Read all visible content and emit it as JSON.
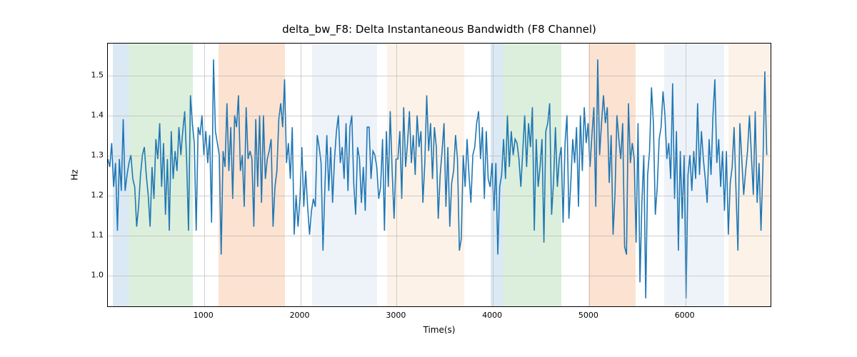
{
  "chart_data": {
    "type": "line",
    "title": "delta_bw_F8: Delta Instantaneous Bandwidth (F8 Channel)",
    "xlabel": "Time(s)",
    "ylabel": "Hz",
    "xlim": [
      0,
      6900
    ],
    "ylim": [
      0.92,
      1.58
    ],
    "xticks": [
      1000,
      2000,
      3000,
      4000,
      5000,
      6000
    ],
    "yticks": [
      1.0,
      1.1,
      1.2,
      1.3,
      1.4,
      1.5
    ],
    "bands": [
      {
        "x0": 50,
        "x1": 220,
        "color": "#a6c8e4"
      },
      {
        "x0": 220,
        "x1": 880,
        "color": "#a8d8a8"
      },
      {
        "x0": 1150,
        "x1": 1840,
        "color": "#f5b78b"
      },
      {
        "x0": 2120,
        "x1": 2800,
        "color": "#d4e2ef"
      },
      {
        "x0": 2900,
        "x1": 3700,
        "color": "#f8dec2"
      },
      {
        "x0": 3980,
        "x1": 4110,
        "color": "#a6c8e4"
      },
      {
        "x0": 4110,
        "x1": 4710,
        "color": "#a8d8a8"
      },
      {
        "x0": 4990,
        "x1": 5480,
        "color": "#f5b78b"
      },
      {
        "x0": 5780,
        "x1": 6400,
        "color": "#d4e2ef"
      },
      {
        "x0": 6450,
        "x1": 6900,
        "color": "#f8dec2"
      }
    ],
    "series": [
      {
        "name": "delta_bw_F8",
        "color": "#1f77b4",
        "x_step": 20,
        "x_start": 0,
        "values": [
          1.29,
          1.27,
          1.33,
          1.22,
          1.28,
          1.11,
          1.29,
          1.21,
          1.39,
          1.21,
          1.25,
          1.28,
          1.3,
          1.24,
          1.22,
          1.12,
          1.17,
          1.25,
          1.3,
          1.32,
          1.25,
          1.2,
          1.12,
          1.27,
          1.19,
          1.34,
          1.29,
          1.38,
          1.22,
          1.33,
          1.15,
          1.29,
          1.11,
          1.36,
          1.24,
          1.31,
          1.26,
          1.37,
          1.3,
          1.36,
          1.41,
          1.29,
          1.11,
          1.45,
          1.38,
          1.33,
          1.11,
          1.37,
          1.35,
          1.4,
          1.3,
          1.36,
          1.28,
          1.35,
          1.13,
          1.54,
          1.36,
          1.33,
          1.3,
          1.05,
          1.31,
          1.27,
          1.43,
          1.26,
          1.37,
          1.19,
          1.4,
          1.37,
          1.45,
          1.26,
          1.3,
          1.17,
          1.42,
          1.29,
          1.31,
          1.29,
          1.12,
          1.39,
          1.22,
          1.4,
          1.18,
          1.4,
          1.24,
          1.29,
          1.31,
          1.34,
          1.12,
          1.22,
          1.26,
          1.39,
          1.43,
          1.37,
          1.49,
          1.28,
          1.33,
          1.24,
          1.37,
          1.1,
          1.2,
          1.12,
          1.19,
          1.32,
          1.17,
          1.26,
          1.17,
          1.1,
          1.16,
          1.19,
          1.17,
          1.35,
          1.32,
          1.28,
          1.06,
          1.22,
          1.35,
          1.21,
          1.32,
          1.18,
          1.29,
          1.36,
          1.4,
          1.28,
          1.32,
          1.24,
          1.38,
          1.21,
          1.37,
          1.4,
          1.23,
          1.15,
          1.32,
          1.29,
          1.18,
          1.27,
          1.16,
          1.37,
          1.37,
          1.24,
          1.31,
          1.3,
          1.27,
          1.19,
          1.22,
          1.34,
          1.11,
          1.36,
          1.22,
          1.41,
          1.26,
          1.14,
          1.29,
          1.29,
          1.36,
          1.19,
          1.42,
          1.27,
          1.33,
          1.41,
          1.28,
          1.35,
          1.25,
          1.4,
          1.32,
          1.36,
          1.18,
          1.28,
          1.45,
          1.31,
          1.38,
          1.24,
          1.37,
          1.32,
          1.14,
          1.25,
          1.31,
          1.38,
          1.17,
          1.32,
          1.12,
          1.23,
          1.26,
          1.35,
          1.29,
          1.06,
          1.09,
          1.3,
          1.22,
          1.34,
          1.25,
          1.18,
          1.3,
          1.32,
          1.38,
          1.41,
          1.29,
          1.37,
          1.19,
          1.36,
          1.24,
          1.22,
          1.28,
          1.16,
          1.28,
          1.05,
          1.22,
          1.25,
          1.34,
          1.24,
          1.4,
          1.27,
          1.36,
          1.3,
          1.34,
          1.33,
          1.29,
          1.22,
          1.31,
          1.4,
          1.27,
          1.38,
          1.32,
          1.42,
          1.11,
          1.34,
          1.22,
          1.27,
          1.34,
          1.08,
          1.36,
          1.38,
          1.43,
          1.15,
          1.23,
          1.37,
          1.22,
          1.29,
          1.32,
          1.13,
          1.33,
          1.4,
          1.14,
          1.23,
          1.34,
          1.28,
          1.37,
          1.17,
          1.4,
          1.26,
          1.42,
          1.33,
          1.38,
          1.27,
          1.35,
          1.42,
          1.17,
          1.54,
          1.3,
          1.38,
          1.45,
          1.38,
          1.42,
          1.23,
          1.35,
          1.1,
          1.2,
          1.4,
          1.34,
          1.29,
          1.38,
          1.07,
          1.05,
          1.43,
          1.28,
          1.33,
          1.29,
          1.08,
          1.38,
          0.98,
          1.18,
          1.3,
          0.94,
          1.25,
          1.31,
          1.47,
          1.38,
          1.15,
          1.22,
          1.34,
          1.37,
          1.46,
          1.4,
          1.29,
          1.33,
          1.24,
          1.48,
          1.19,
          1.36,
          1.06,
          1.31,
          1.14,
          1.3,
          0.94,
          1.25,
          1.3,
          1.21,
          1.31,
          1.24,
          1.43,
          1.25,
          1.36,
          1.29,
          1.24,
          1.18,
          1.34,
          1.25,
          1.4,
          1.49,
          1.28,
          1.34,
          1.22,
          1.31,
          1.16,
          1.31,
          1.1,
          1.23,
          1.27,
          1.37,
          1.21,
          1.06,
          1.38,
          1.29,
          1.2,
          1.26,
          1.31,
          1.4,
          1.3,
          1.2,
          1.41,
          1.18,
          1.28,
          1.11,
          1.27,
          1.51,
          1.3
        ]
      }
    ]
  }
}
